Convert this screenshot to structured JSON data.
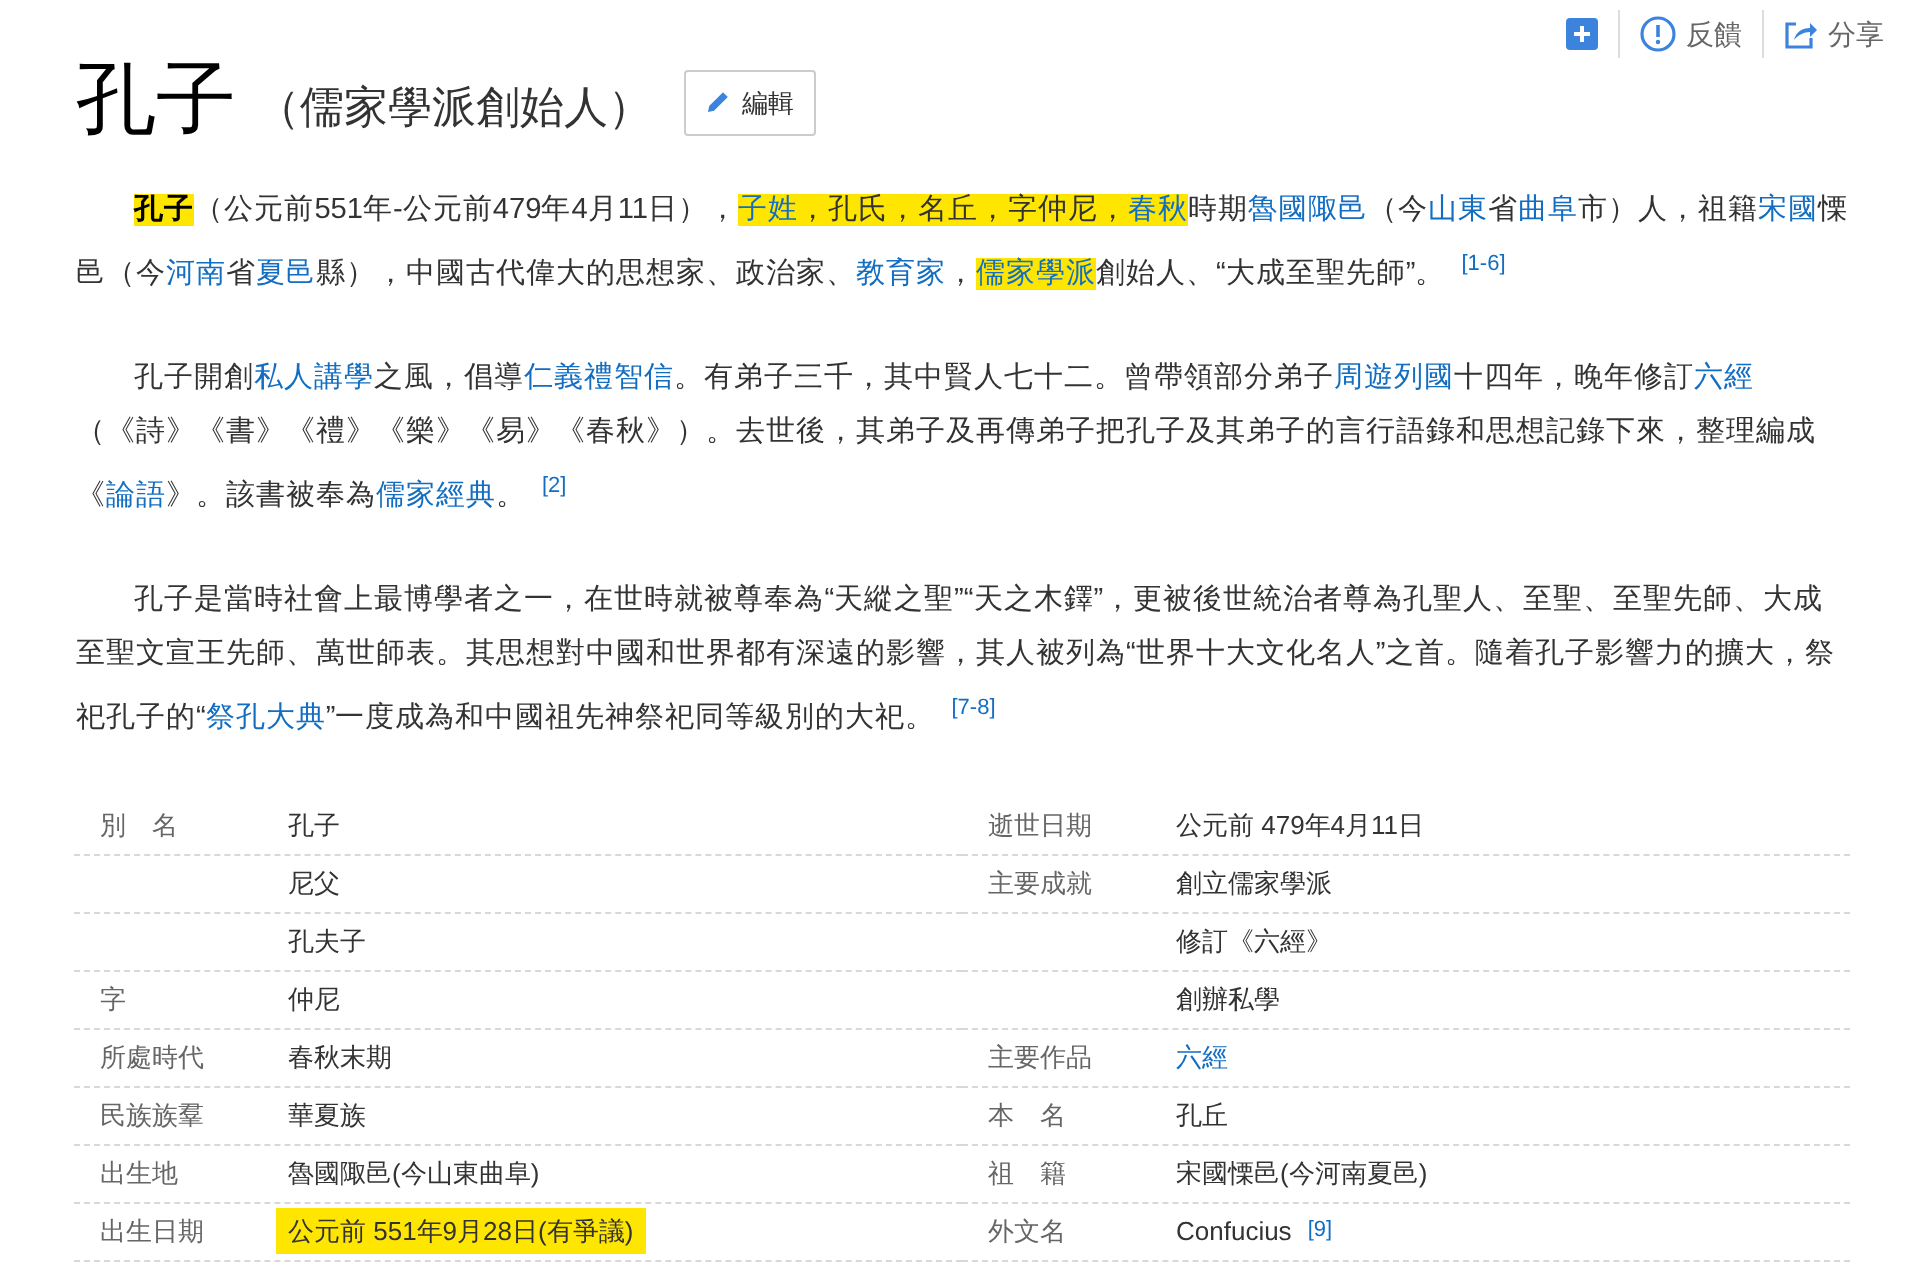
{
  "toolbar": {
    "items": [
      {
        "kind": "add"
      },
      {
        "kind": "feedback",
        "label": "反饋"
      },
      {
        "kind": "share",
        "label": "分享"
      }
    ]
  },
  "title": "孔子",
  "subtitle": "（儒家學派創始人）",
  "edit_button": "編輯",
  "paragraphs": [
    {
      "segments": [
        {
          "kind": "bold",
          "text": "孔子",
          "highlighted": true
        },
        {
          "kind": "text",
          "text": "（公元前551年-公元前479年4月11日），",
          "highlighted": false
        },
        {
          "kind": "link",
          "text": "子姓",
          "highlighted": true
        },
        {
          "kind": "text",
          "text": "，孔氏，名丘，字仲尼，",
          "highlighted": true
        },
        {
          "kind": "link",
          "text": "春秋",
          "highlighted": true
        },
        {
          "kind": "text",
          "text": "時期",
          "highlighted": false
        },
        {
          "kind": "link",
          "text": "魯國陬邑",
          "highlighted": false
        },
        {
          "kind": "text",
          "text": "（今",
          "highlighted": false
        },
        {
          "kind": "link",
          "text": "山東",
          "highlighted": false
        },
        {
          "kind": "text",
          "text": "省",
          "highlighted": false
        },
        {
          "kind": "link",
          "text": "曲阜",
          "highlighted": false
        },
        {
          "kind": "text",
          "text": "市）人，祖籍",
          "highlighted": false
        },
        {
          "kind": "link",
          "text": "宋國",
          "highlighted": false
        },
        {
          "kind": "text",
          "text": "慄邑（今",
          "highlighted": false
        },
        {
          "kind": "link",
          "text": "河南",
          "highlighted": false
        },
        {
          "kind": "text",
          "text": "省",
          "highlighted": false
        },
        {
          "kind": "link",
          "text": "夏邑",
          "highlighted": false
        },
        {
          "kind": "text",
          "text": "縣），中國古代偉大的思想家、政治家、",
          "highlighted": false
        },
        {
          "kind": "link",
          "text": "教育家",
          "highlighted": false
        },
        {
          "kind": "text",
          "text": "，",
          "highlighted": false
        },
        {
          "kind": "link",
          "text": "儒家學派",
          "highlighted": true
        },
        {
          "kind": "text",
          "text": "創始人、“大成至聖先師”。",
          "highlighted": false
        },
        {
          "kind": "ref",
          "text": "[1-6]",
          "highlighted": false
        }
      ]
    },
    {
      "segments": [
        {
          "kind": "text",
          "text": "孔子開創"
        },
        {
          "kind": "link",
          "text": "私人講學"
        },
        {
          "kind": "text",
          "text": "之風，倡導"
        },
        {
          "kind": "link",
          "text": "仁義禮智信"
        },
        {
          "kind": "text",
          "text": "。有弟子三千，其中賢人七十二。曾帶領部分弟子"
        },
        {
          "kind": "link",
          "text": "周遊列國"
        },
        {
          "kind": "text",
          "text": "十四年，晚年修訂"
        },
        {
          "kind": "link",
          "text": "六經"
        },
        {
          "kind": "text",
          "text": "（《詩》《書》《禮》《樂》《易》《春秋》）。去世後，其弟子及再傳弟子把孔子及其弟子的言行語錄和思想記錄下來，整理編成《"
        },
        {
          "kind": "link",
          "text": "論語"
        },
        {
          "kind": "text",
          "text": "》。該書被奉為"
        },
        {
          "kind": "link",
          "text": "儒家經典"
        },
        {
          "kind": "text",
          "text": "。"
        },
        {
          "kind": "ref",
          "text": "[2]"
        }
      ]
    },
    {
      "segments": [
        {
          "kind": "text",
          "text": "孔子是當時社會上最博學者之一，在世時就被尊奉為“天縱之聖”“天之木鐸”，更被後世統治者尊為孔聖人、至聖、至聖先師、大成至聖文宣王先師、萬世師表。其思想對中國和世界都有深遠的影響，其人被列為“世界十大文化名人”之首。隨着孔子影響力的擴大，祭祀孔子的“"
        },
        {
          "kind": "link",
          "text": "祭孔大典"
        },
        {
          "kind": "text",
          "text": "”一度成為和中國祖先神祭祀同等級別的大祀。"
        },
        {
          "kind": "ref",
          "text": "[7-8]"
        }
      ]
    }
  ],
  "infobox": {
    "columns": [
      {
        "rows": [
          {
            "label": "別　名",
            "value": "孔子",
            "link": false,
            "highlighted": false
          },
          {
            "value": "尼父",
            "link": false,
            "highlighted": false
          },
          {
            "value": "孔夫子",
            "link": false,
            "highlighted": false
          },
          {
            "label": "字",
            "value": "仲尼",
            "link": false,
            "highlighted": false
          },
          {
            "label": "所處時代",
            "value": "春秋末期",
            "link": false,
            "highlighted": false
          },
          {
            "label": "民族族羣",
            "value": "華夏族",
            "link": false,
            "highlighted": false
          },
          {
            "label": "出生地",
            "value": "魯國陬邑(今山東曲阜)",
            "link": false,
            "highlighted": false
          },
          {
            "label": "出生日期",
            "value": "公元前 551年9月28日(有爭議)",
            "link": false,
            "highlighted": true
          }
        ]
      },
      {
        "rows": [
          {
            "label": "逝世日期",
            "value": "公元前 479年4月11日",
            "link": false,
            "highlighted": false
          },
          {
            "label": "主要成就",
            "value": "創立儒家學派",
            "link": false,
            "highlighted": false
          },
          {
            "value": "修訂《六經》",
            "link": false,
            "highlighted": false
          },
          {
            "value": "創辦私學",
            "link": false,
            "highlighted": false
          },
          {
            "label": "主要作品",
            "value": "六經",
            "link": true,
            "highlighted": false
          },
          {
            "label": "本　名",
            "value": "孔丘",
            "link": false,
            "highlighted": false
          },
          {
            "label": "祖　籍",
            "value": "宋國慄邑(今河南夏邑)",
            "link": false,
            "highlighted": false
          },
          {
            "label": "外文名",
            "value": "Confucius",
            "ref": "[9]",
            "link": false,
            "highlighted": false
          }
        ]
      }
    ]
  }
}
